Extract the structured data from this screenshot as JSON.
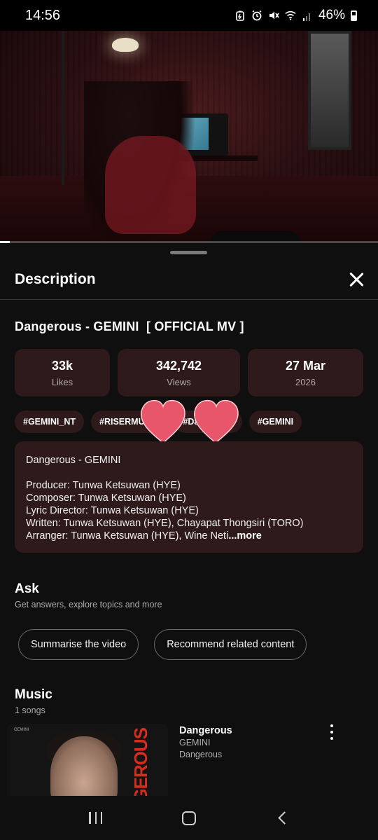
{
  "status_bar": {
    "time": "14:56",
    "battery": "46%",
    "icons": [
      "battery-saver-icon",
      "alarm-icon",
      "mute-icon",
      "wifi-icon",
      "signal-icon",
      "battery-icon"
    ]
  },
  "video": {
    "progress_fraction": 0.025
  },
  "sheet": {
    "title": "Description"
  },
  "video_title": "Dangerous - GEMINI  [ OFFICIAL MV ]",
  "stats": {
    "likes_value": "33k",
    "likes_label": "Likes",
    "views_value": "342,742",
    "views_label": "Views",
    "date_value": "27 Mar",
    "date_year": "2026"
  },
  "hashtags": [
    "#GEMINI_NT",
    "#RISERMUSIC",
    "#Dangerous",
    "#GEMINI"
  ],
  "description": {
    "lines": [
      "Dangerous - GEMINI",
      "",
      "Producer: Tunwa Ketsuwan (HYE)",
      "Composer: Tunwa Ketsuwan (HYE)",
      "Lyric Director: Tunwa Ketsuwan (HYE)",
      "Written: Tunwa Ketsuwan (HYE), Chayapat Thongsiri (TORO)",
      "Arranger: Tunwa Ketsuwan (HYE), Wine Neti"
    ],
    "more": "...more"
  },
  "ask": {
    "title": "Ask",
    "subtitle": "Get answers, explore topics and more",
    "buttons": [
      "Summarise the video",
      "Recommend related content"
    ]
  },
  "music": {
    "title": "Music",
    "subtitle": "1 songs",
    "song": {
      "name": "Dangerous",
      "artist": "GEMINI",
      "album": "Dangerous",
      "thumb_text": "DANGEROUS",
      "thumb_small": "GEMINI"
    }
  },
  "colors": {
    "background": "#0f0f0f",
    "card": "#2e1a1b",
    "heart": "#e8566b"
  }
}
